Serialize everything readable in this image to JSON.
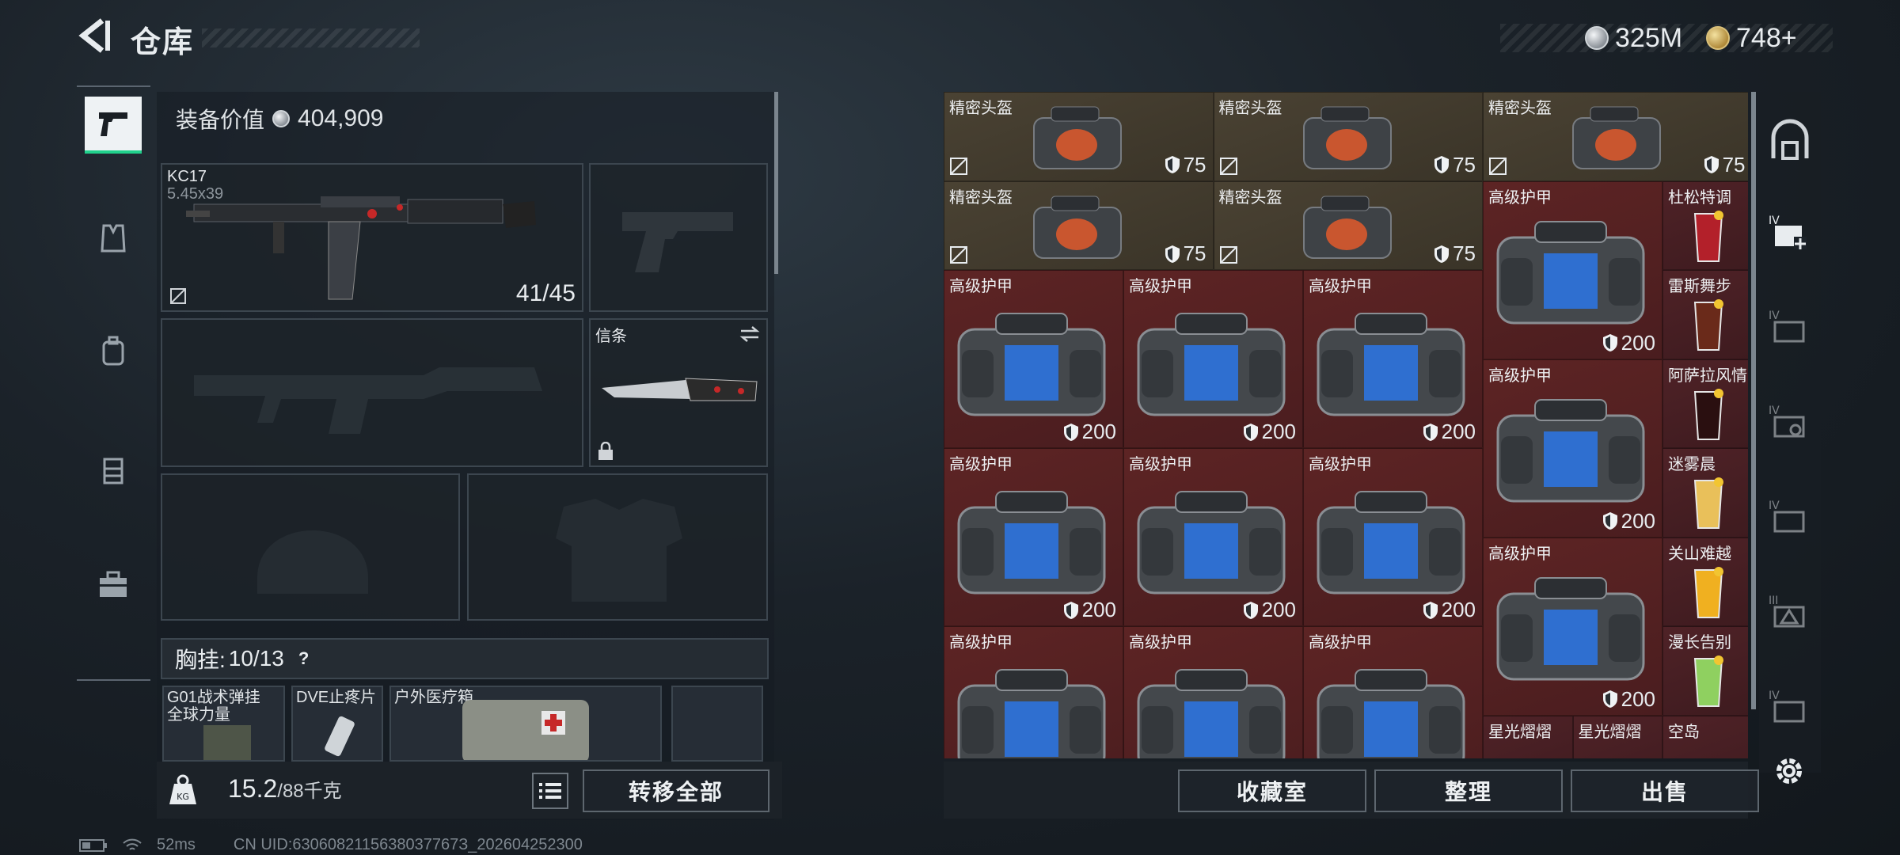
{
  "header": {
    "title": "仓库",
    "currencies": [
      {
        "value": "325M",
        "icon": "silver-coin-icon"
      },
      {
        "value": "748+",
        "icon": "gold-coin-icon"
      }
    ]
  },
  "left_tabs": [
    {
      "name": "weapons",
      "icon": "pistol-icon",
      "active": true
    },
    {
      "name": "armor",
      "icon": "vest-icon"
    },
    {
      "name": "backpack",
      "icon": "backpack-icon"
    },
    {
      "name": "rig",
      "icon": "rig-icon"
    },
    {
      "name": "case",
      "icon": "briefcase-icon"
    }
  ],
  "loadout": {
    "equip_value_label": "装备价值",
    "equip_value": "404,909",
    "primary": {
      "name": "KC17",
      "caliber": "5.45x39",
      "ammo": "41/45"
    },
    "melee": {
      "name": "信条"
    },
    "chest_rig_label": "胸挂:",
    "chest_rig_capacity": "10/13",
    "help": "?",
    "chest_items": [
      {
        "line1": "G01战术弹挂",
        "line2": "全球力量"
      },
      {
        "line1": "DVE止疼片",
        "line2": ""
      },
      {
        "line1": "户外医疗箱",
        "line2": ""
      }
    ],
    "weight": "15.2",
    "weight_max": "/88千克",
    "transfer_all": "转移全部"
  },
  "stash": {
    "rows": [
      [
        {
          "name": "精密头盔",
          "value": "75",
          "kind": "helmet"
        },
        {
          "name": "精密头盔",
          "value": "75",
          "kind": "helmet"
        },
        {
          "name": "精密头盔",
          "value": "75",
          "kind": "helmet"
        }
      ],
      [
        {
          "name": "精密头盔",
          "value": "75",
          "kind": "helmet"
        },
        {
          "name": "精密头盔",
          "value": "75",
          "kind": "helmet"
        }
      ]
    ],
    "armor_label": "高级护甲",
    "armor_value": "200",
    "drinks": [
      "杜松特调",
      "雷斯舞步",
      "阿萨拉风情",
      "迷雾晨",
      "关山难越",
      "漫长告别"
    ],
    "bottom_row": [
      "星光熠熠",
      "星光熠熠",
      "空岛"
    ],
    "buttons": [
      "收藏室",
      "整理",
      "出售"
    ]
  },
  "status_bar": {
    "ping": "52ms",
    "uid": "CN UID:6306082115638037767З_202604252300"
  },
  "colors": {
    "accent_green": "#21d18c",
    "armor_red": "#5d2424",
    "helmet_brown": "#4a4233"
  }
}
